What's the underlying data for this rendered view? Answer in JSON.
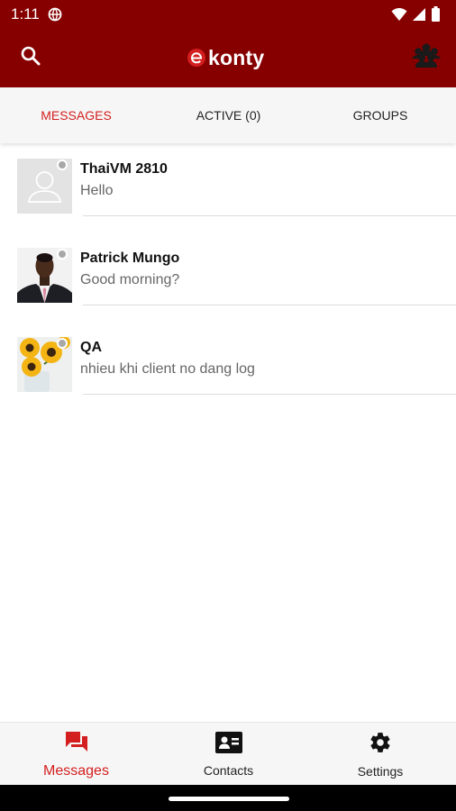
{
  "status_bar": {
    "time": "1:11",
    "icons": [
      "vpn-globe-icon",
      "wifi-icon",
      "signal-icon",
      "battery-icon"
    ]
  },
  "app_bar": {
    "logo_text": "konty",
    "left_icon": "search-icon",
    "right_icon": "groups-icon",
    "background_color": "#870000"
  },
  "tabs": [
    {
      "label": "MESSAGES",
      "selected": true
    },
    {
      "label": "ACTIVE (0)",
      "selected": false
    },
    {
      "label": "GROUPS",
      "selected": false
    }
  ],
  "conversations": [
    {
      "name": "ThaiVM 2810",
      "preview": "Hello",
      "avatar": "default-avatar",
      "online": false
    },
    {
      "name": "Patrick Mungo",
      "preview": "Good morning?",
      "avatar": "photo-man-suit",
      "online": false
    },
    {
      "name": "QA",
      "preview": "nhieu khi client no dang log",
      "avatar": "photo-sunflowers",
      "online": false
    }
  ],
  "bottom_nav": [
    {
      "label": "Messages",
      "icon": "messages-icon",
      "selected": true
    },
    {
      "label": "Contacts",
      "icon": "contacts-icon",
      "selected": false
    },
    {
      "label": "Settings",
      "icon": "settings-icon",
      "selected": false
    }
  ],
  "colors": {
    "brand": "#870000",
    "accent": "#d31f1f",
    "presence_offline": "#a8a8a8"
  }
}
